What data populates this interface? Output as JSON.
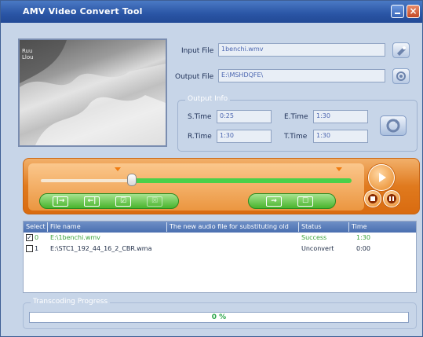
{
  "window": {
    "title": "AMV Video Convert Tool",
    "close_glyph": "×"
  },
  "preview": {
    "overlay_text": [
      "Ruu",
      "Llou"
    ]
  },
  "inputs": {
    "input_file_label": "Input File",
    "input_file_value": "1benchi.wmv",
    "output_file_label": "Output File",
    "output_file_value": "E:\\MSHDQFE\\"
  },
  "output_info": {
    "title": "Output Info",
    "s_time_label": "S.Time",
    "s_time_value": "0:25",
    "e_time_label": "E.Time",
    "e_time_value": "1:30",
    "r_time_label": "R.Time",
    "r_time_value": "1:30",
    "t_time_label": "T.Time",
    "t_time_value": "1:30"
  },
  "player": {
    "buttons": [
      "|→",
      "←|",
      "☑",
      "☒"
    ],
    "right_buttons": [
      "⇝",
      "☐"
    ],
    "accent": "#e07a1e",
    "track_color": "#4ad04a"
  },
  "list": {
    "headers": [
      "Select",
      "File name",
      "The new audio file for substituting old",
      "Status",
      "Time"
    ],
    "rows": [
      {
        "checked": true,
        "index": "0",
        "file": "E:\\1benchi.wmv",
        "status": "Success",
        "time": "1:30"
      },
      {
        "checked": false,
        "index": "1",
        "file": "E:\\STC1_192_44_16_2_CBR.wma",
        "status": "Unconvert",
        "time": "0:00"
      }
    ]
  },
  "progress": {
    "title": "Transcoding Progress",
    "value": 0,
    "text": "0 %"
  }
}
